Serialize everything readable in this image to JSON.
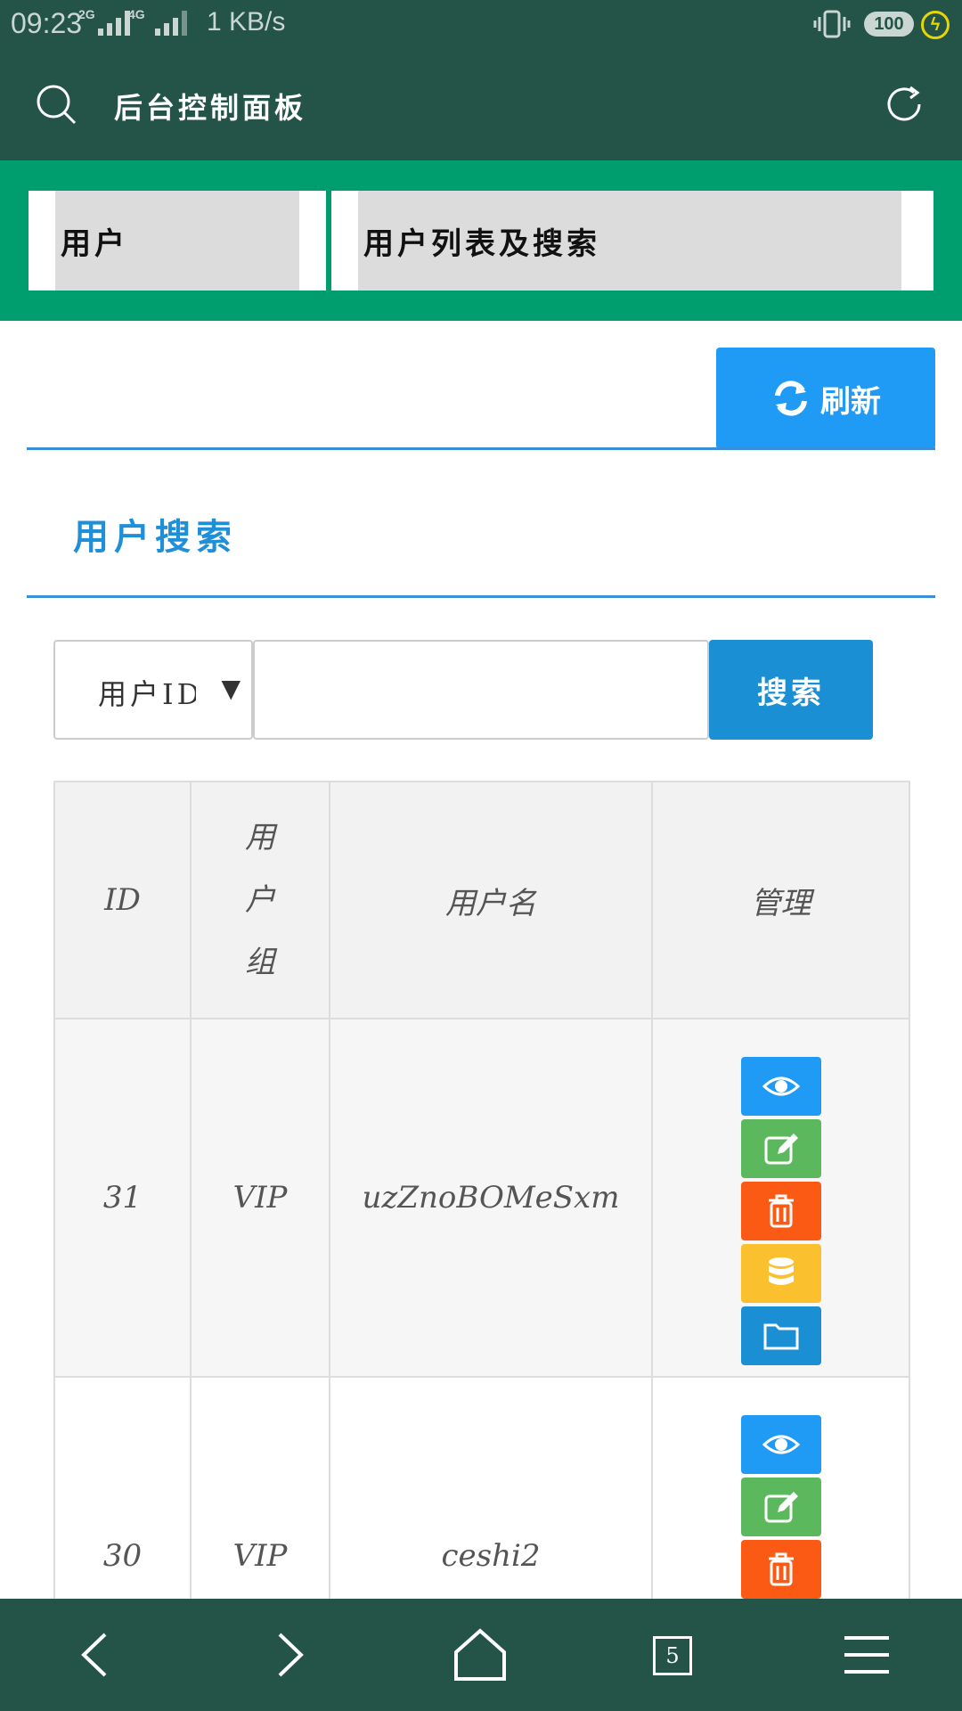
{
  "status_bar": {
    "time": "09:23",
    "network1": "2G",
    "network2": "4G",
    "speed": "1 KB/s",
    "battery": "100"
  },
  "header": {
    "title": "后台控制面板"
  },
  "breadcrumb": {
    "items": [
      "用户",
      "用户列表及搜索"
    ]
  },
  "toolbar": {
    "refresh_label": "刷新"
  },
  "search_section": {
    "title": "用户搜索",
    "select_value": "用户ID",
    "input_value": "",
    "search_label": "搜索"
  },
  "table": {
    "headers": {
      "id": "ID",
      "group": [
        "用",
        "户",
        "组"
      ],
      "username": "用户名",
      "manage": "管理"
    },
    "rows": [
      {
        "id": "31",
        "group": "VIP",
        "username": "uzZnoBOMeSxm"
      },
      {
        "id": "30",
        "group": "VIP",
        "username": "ceshi2"
      }
    ]
  },
  "bottom_nav": {
    "tab_count": "5"
  },
  "colors": {
    "header_bg": "#245347",
    "breadcrumb_bg": "#009e6f",
    "primary_blue": "#1f9bf5",
    "green": "#5cb85c",
    "orange": "#fa5a14",
    "yellow": "#fbc02d"
  }
}
